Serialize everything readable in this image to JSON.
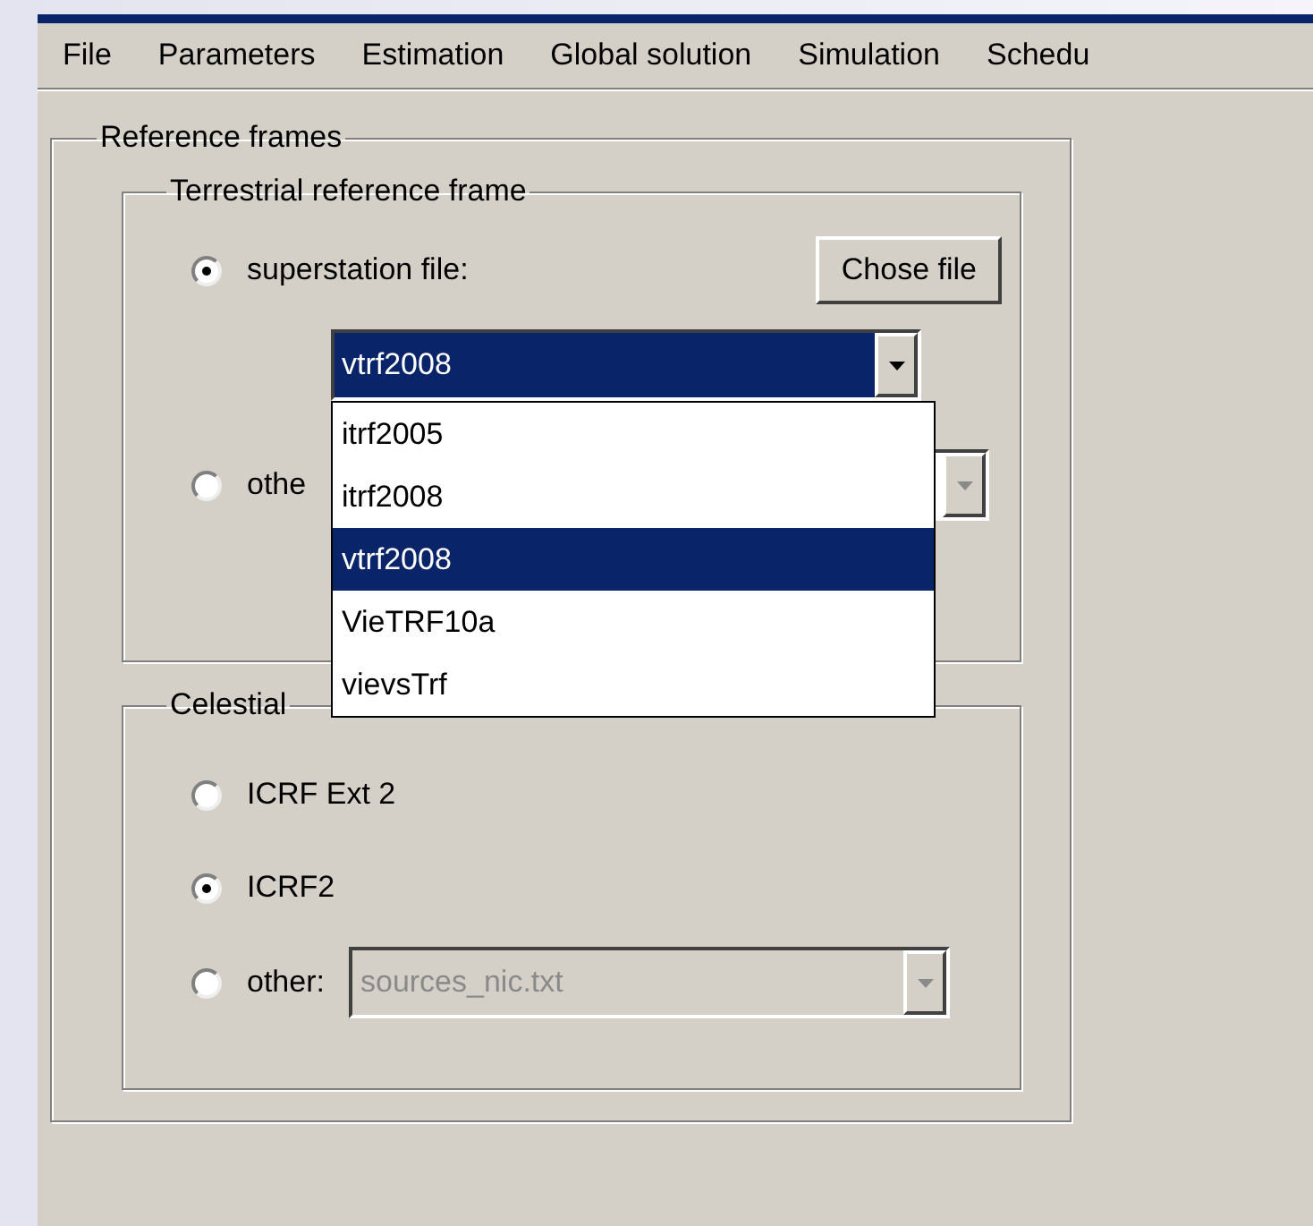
{
  "menu": [
    {
      "label": "File"
    },
    {
      "label": "Parameters"
    },
    {
      "label": "Estimation"
    },
    {
      "label": "Global solution"
    },
    {
      "label": "Simulation"
    },
    {
      "label": "Schedu"
    }
  ],
  "reference_frames": {
    "title": "Reference frames",
    "terrestrial": {
      "title": "Terrestrial reference frame",
      "file_button": "Chose file",
      "options": [
        {
          "kind": "file",
          "label": "superstation file:",
          "selected": true
        },
        {
          "kind": "other",
          "label": "othe",
          "selected": false
        }
      ],
      "combo": {
        "value": "vtrf2008",
        "focused": true,
        "expanded": true,
        "list": [
          {
            "label": "itrf2005",
            "selected": false
          },
          {
            "label": "itrf2008",
            "selected": false
          },
          {
            "label": "vtrf2008",
            "selected": true
          },
          {
            "label": "VieTRF10a",
            "selected": false
          },
          {
            "label": "vievsTrf",
            "selected": false
          }
        ]
      }
    },
    "celestial": {
      "title": "Celestial",
      "options": [
        {
          "kind": "plain",
          "label": "ICRF Ext 2",
          "selected": false
        },
        {
          "kind": "plain",
          "label": "ICRF2",
          "selected": true
        },
        {
          "kind": "combo",
          "label": "other:",
          "selected": false,
          "value": "sources_nic.txt",
          "disabled": true
        }
      ]
    }
  }
}
